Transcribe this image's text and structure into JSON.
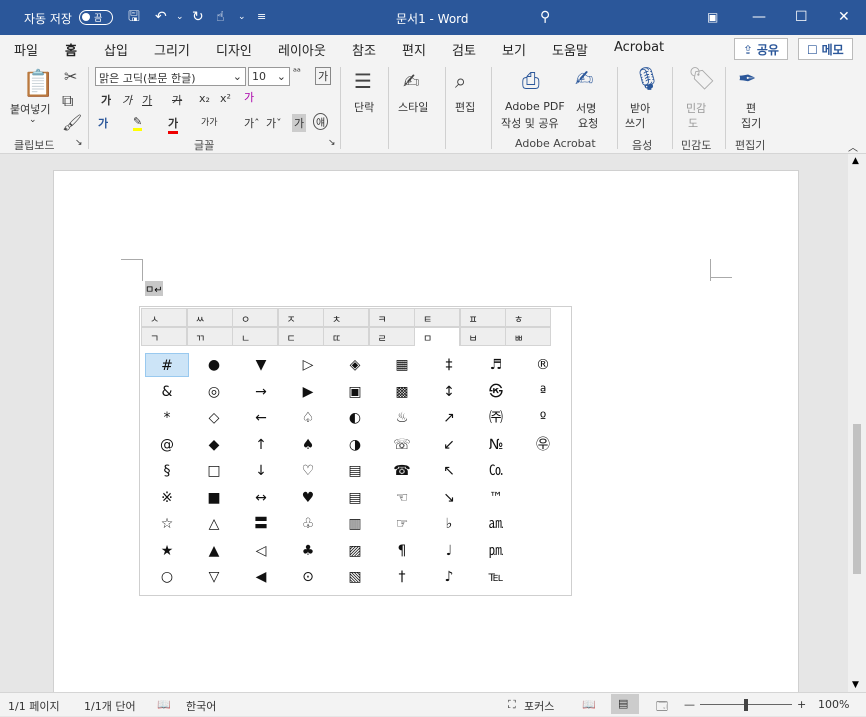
{
  "titlebar": {
    "autosave": "자동 저장",
    "toggle": "끔",
    "doc_title": "문서1 - Word",
    "search_icon": "search-icon"
  },
  "menu": {
    "tabs": [
      "파일",
      "홈",
      "삽입",
      "그리기",
      "디자인",
      "레이아웃",
      "참조",
      "편지",
      "검토",
      "보기",
      "도움말",
      "Acrobat"
    ],
    "share": "공유",
    "memo": "메모"
  },
  "ribbon": {
    "clipboard": {
      "paste": "붙여넣기",
      "group": "클립보드"
    },
    "font": {
      "name": "맑은 고딕(본문 한글)",
      "size": "10",
      "group": "글꼴",
      "ganada": "가"
    },
    "paragraph": "단락",
    "style": "스타일",
    "edit": "편집",
    "adobe": {
      "create": "Adobe PDF",
      "create2": "작성 및 공유",
      "sign": "서명",
      "sign2": "요청",
      "group": "Adobe Acrobat"
    },
    "voice": {
      "label": "받아",
      "label2": "쓰기",
      "group": "음성"
    },
    "sensitivity": {
      "label": "민감",
      "label2": "도",
      "group": "민감도"
    },
    "editor": {
      "label": "편",
      "label2": "집기",
      "group": "편집기"
    }
  },
  "document": {
    "cursor_text": "ㅁ↵"
  },
  "char_tabs": {
    "row1": [
      "ㅅ",
      "ㅆ",
      "ㅇ",
      "ㅈ",
      "ㅊ",
      "ㅋ",
      "ㅌ",
      "ㅍ",
      "ㅎ"
    ],
    "row2": [
      "ㄱ",
      "ㄲ",
      "ㄴ",
      "ㄷ",
      "ㄸ",
      "ㄹ",
      "ㅁ",
      "ㅂ",
      "ㅃ"
    ]
  },
  "symbols": [
    [
      "#",
      "●",
      "▼",
      "▷",
      "◈",
      "▦",
      "‡",
      "♬",
      "®"
    ],
    [
      "&",
      "◎",
      "→",
      "▶",
      "▣",
      "▩",
      "↕",
      "㉿",
      "ª"
    ],
    [
      "*",
      "◇",
      "←",
      "♤",
      "◐",
      "♨",
      "↗",
      "㈜",
      "º"
    ],
    [
      "@",
      "◆",
      "↑",
      "♠",
      "◑",
      "☏",
      "↙",
      "№",
      "㉾"
    ],
    [
      "§",
      "□",
      "↓",
      "♡",
      "▤",
      "☎",
      "↖",
      "㏇",
      ""
    ],
    [
      "※",
      "■",
      "↔",
      "♥",
      "▤",
      "☜",
      "↘",
      "™",
      ""
    ],
    [
      "☆",
      "△",
      "〓",
      "♧",
      "▥",
      "☞",
      "♭",
      "㏂",
      ""
    ],
    [
      "★",
      "▲",
      "◁",
      "♣",
      "▨",
      "¶",
      "♩",
      "㏘",
      ""
    ],
    [
      "○",
      "▽",
      "◀",
      "⊙",
      "▧",
      "†",
      "♪",
      "℡",
      ""
    ]
  ],
  "status": {
    "page": "1/1 페이지",
    "words": "1/1개 단어",
    "lang": "한국어",
    "focus": "포커스",
    "zoom": "100%"
  }
}
